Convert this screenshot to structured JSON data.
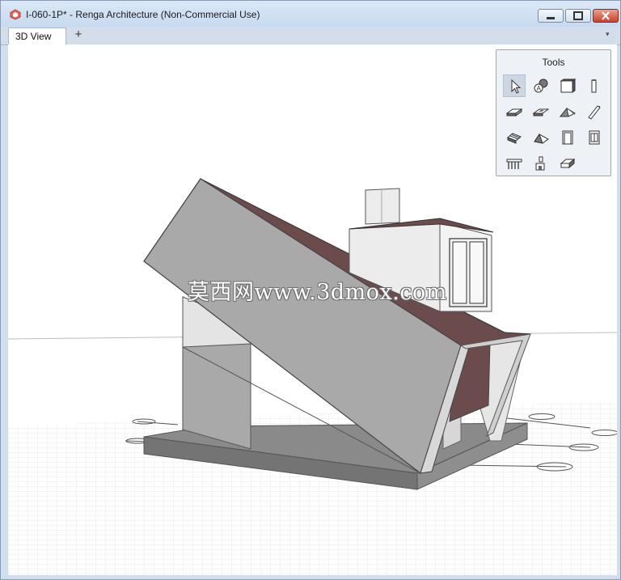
{
  "window": {
    "title": "I-060-1P* - Renga Architecture (Non-Commercial Use)"
  },
  "tabs": [
    {
      "label": "3D View",
      "active": true
    }
  ],
  "tab_add_label": "+",
  "tab_menu_label": "▾",
  "watermark": "莫西网www.3dmox.com",
  "tools_panel": {
    "title": "Tools",
    "selected": "select",
    "items": [
      "select",
      "annotation",
      "wall",
      "column",
      "floor",
      "opening",
      "roof",
      "beam",
      "stair",
      "ramp",
      "door",
      "window",
      "railing",
      "equipment",
      "element"
    ]
  },
  "colors": {
    "roof": "#6b4b4b",
    "wall": "#a8a8a8",
    "slab": "#7f7f7f",
    "titlebar": "#c7daef"
  }
}
